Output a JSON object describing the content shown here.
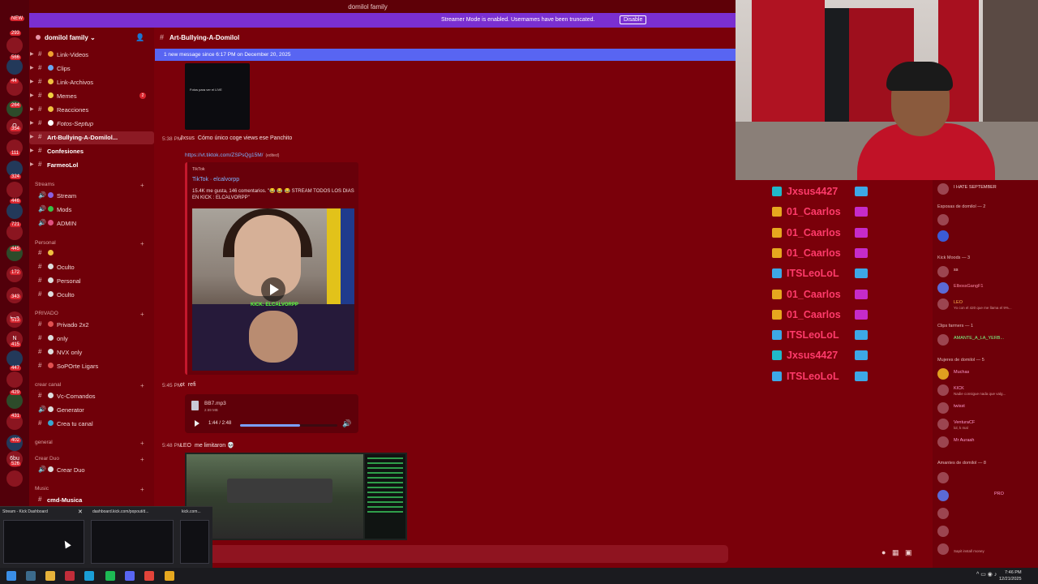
{
  "window": {
    "title": "domilol family"
  },
  "streamer_mode": {
    "message": "Streamer Mode is enabled. Usernames have been truncated.",
    "button": "Disable"
  },
  "server_rail": {
    "top_badge": "NEW",
    "badges": [
      "293",
      "566",
      "44",
      "264",
      "354",
      "111",
      "324",
      "446",
      "721",
      "445",
      "172",
      "343",
      "513",
      "415",
      "447",
      "429",
      "431",
      "402",
      "526"
    ],
    "letters": {
      "o": "O",
      "n": "N",
      "bs": "bs2",
      "b": "6bu"
    }
  },
  "server": {
    "name": "domilol family"
  },
  "channels": [
    {
      "label": "Link-Videos",
      "bold": false
    },
    {
      "label": "Clips",
      "bold": false
    },
    {
      "label": "Link-Archivos",
      "bold": false
    },
    {
      "label": "Memes",
      "bold": false,
      "count": "2"
    },
    {
      "label": "Reacciones",
      "bold": false
    },
    {
      "label": "Fotos-Septup",
      "bold": false
    },
    {
      "label": "Art-Bullying-A-Domilol...",
      "bold": true,
      "active": true
    },
    {
      "label": "Confesiones",
      "bold": true
    },
    {
      "label": "FarmeoLol",
      "bold": true
    }
  ],
  "categories": {
    "streams": {
      "title": "Streams",
      "items": [
        "Stream",
        "Mods",
        "ADMIN"
      ]
    },
    "personal": {
      "title": "Personal",
      "items": [
        "",
        "Oculto",
        "Personal",
        "Oculto"
      ]
    },
    "privado": {
      "title": "PRIVADO",
      "items": [
        "Privado 2x2",
        "only",
        "NVX only",
        "SoPOrte Ligars"
      ]
    },
    "crear_canal": {
      "title": "crear canal",
      "items": [
        "Vc-Comandos",
        "Generator",
        "Crea tu canal"
      ]
    },
    "general": {
      "title": "general"
    },
    "crear_duo": {
      "title": "Crear Duo",
      "items": [
        "Crear Duo"
      ]
    },
    "music": {
      "title": "Music",
      "items": [
        "cmd-Musica"
      ]
    }
  },
  "chat_header": {
    "channel": "Art-Bullying-A-Domilol"
  },
  "new_message_bar": {
    "text": "1 new message since 6:17 PM on December 20, 2025"
  },
  "messages": {
    "m1": {
      "time": "5:38 PM",
      "author": "Jxsus",
      "text": "Cómo único coge views ese Panchito"
    },
    "link": {
      "url": "https://vt.tiktok.com/ZSPsQg15M/",
      "edited": "(edited)"
    },
    "embed": {
      "provider": "TikTok",
      "title": "TikTok · elcalvorpp",
      "description": "15.4K me gusta, 146 comentarios. \"😂 😂 😂 STREAM TODOS LOS DIAS EN KICK : ELCALVORPP\"",
      "overlay": "KICK: ELCALVORPP"
    },
    "m2": {
      "time": "5:45 PM",
      "author": "ot",
      "text": "refi"
    },
    "audio": {
      "filename": "BB7.mp3",
      "size": "2.59 MB",
      "time": "1:44 / 2:48",
      "progress": 0.62
    },
    "m3": {
      "time": "5:48 PM",
      "author": "LEO",
      "text": "me limitaron 💀"
    }
  },
  "thumb_top": {
    "caption": "Fotos para ver el LIVE"
  },
  "overlay_chat": [
    {
      "user": "Jxsus4427",
      "color": "#ff3b6b",
      "badge": "#21b9c9"
    },
    {
      "user": "01_Caarlos",
      "color": "#ff3b6b",
      "badge": "#e6a81f"
    },
    {
      "user": "01_Caarlos",
      "color": "#ff3b6b",
      "badge": "#e6a81f"
    },
    {
      "user": "01_Caarlos",
      "color": "#ff3b6b",
      "badge": "#e6a81f"
    },
    {
      "user": "ITSLeoLoL",
      "color": "#ff3b6b",
      "badge": "#3da8e6"
    },
    {
      "user": "01_Caarlos",
      "color": "#ff3b6b",
      "badge": "#e6a81f"
    },
    {
      "user": "01_Caarlos",
      "color": "#ff3b6b",
      "badge": "#e6a81f"
    },
    {
      "user": "ITSLeoLoL",
      "color": "#ff3b6b",
      "badge": "#3da8e6"
    },
    {
      "user": "Jxsus4427",
      "color": "#ff3b6b",
      "badge": "#21b9c9"
    },
    {
      "user": "ITSLeoLoL",
      "color": "#ff3b6b",
      "badge": "#3da8e6"
    }
  ],
  "members": {
    "top_status": "I HATE SEPTEMBER",
    "groups": [
      {
        "title": "Esposas de domilol — 2",
        "items": [
          {
            "name": "",
            "status": ""
          },
          {
            "name": "",
            "status": ""
          }
        ]
      },
      {
        "title": "Kick Moods — 3",
        "items": [
          {
            "name": "",
            "status": "ss"
          },
          {
            "name": "ElbossGangF1",
            "status": ""
          },
          {
            "name": "LEO",
            "status": "Yo con el 420 que me llama el 9%..."
          }
        ]
      },
      {
        "title": "Clips farmers — 1",
        "items": [
          {
            "name": "AMANTE_A_LA_YERB...",
            "status": ""
          }
        ]
      },
      {
        "title": "Mujeres de domilol — 5",
        "items": [
          {
            "name": "Muchas",
            "status": ""
          },
          {
            "name": "KICK",
            "status": "Nadie consigue nada que valg..."
          },
          {
            "name": "twisst",
            "status": ""
          },
          {
            "name": "VenturaCF",
            "status": "lol, k mal"
          },
          {
            "name": "Mr Auraah",
            "status": ""
          }
        ]
      },
      {
        "title": "Amantes de domilol — 8",
        "items": [
          {
            "name": "",
            "status": ""
          },
          {
            "name": "PRO",
            "status": ""
          },
          {
            "name": "",
            "status": ""
          },
          {
            "name": "",
            "status": ""
          },
          {
            "name": "",
            "status": "Sapit install money"
          }
        ]
      }
    ]
  },
  "taskbar": {
    "preview_tabs": [
      "Stream - Kick Dashboard",
      "dashboard.kick.com/popout/d...",
      "kick.com..."
    ],
    "clock_time": "7:46 PM",
    "clock_date": "12/21/2025"
  },
  "colors": {
    "accent": "#7a2fd1",
    "new_msg": "#5865f2",
    "bg": "#7a000a",
    "link": "#7db3ff"
  }
}
